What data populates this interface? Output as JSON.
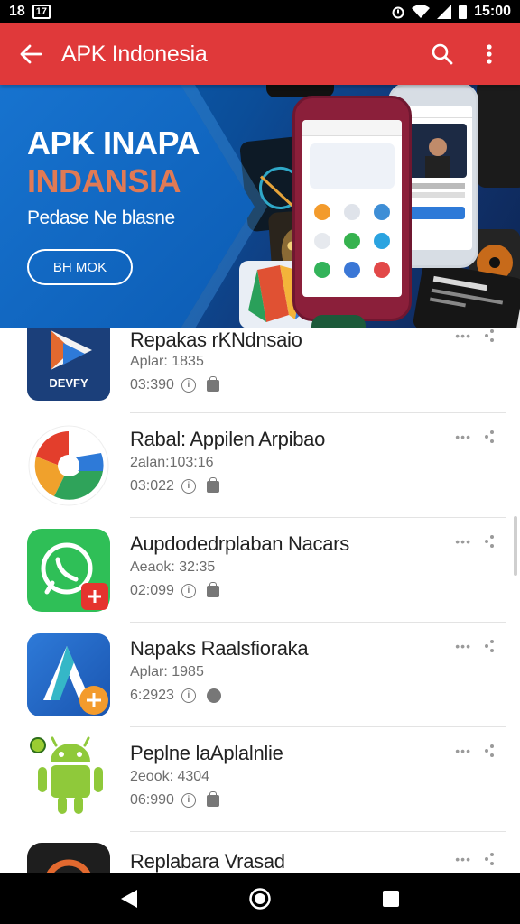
{
  "status_bar": {
    "left_text": "18",
    "left_badge": "17",
    "time": "15:00",
    "icons": [
      "alarm-icon",
      "wifi-icon",
      "signal-icon",
      "battery-icon"
    ]
  },
  "app_bar": {
    "title": "APK Indonesia",
    "icons": [
      "back-arrow-icon",
      "search-icon",
      "more-vert-icon"
    ]
  },
  "banner": {
    "headline_1": "APK INAPA",
    "headline_2": "INDANSIA",
    "subtitle": "Pedase Ne blasne",
    "button_label": "BH MOK",
    "colors": {
      "accent_orange": "#e07a55",
      "blue": "#0c5cb4"
    }
  },
  "apps": [
    {
      "title": "Repakas rKNdnsaio",
      "subtitle": "Aplar: 1835",
      "meta": "03:390",
      "icon_label": "DEVFY",
      "icon": "play-store-like-icon"
    },
    {
      "title": "Rabal: Appilen Arpibao",
      "subtitle": "2alan:103:16",
      "meta": "03:022",
      "icon": "google-like-g-icon"
    },
    {
      "title": "Aupdodedrplaban Nacars",
      "subtitle": "Aeaok: 32:35",
      "meta": "02:099",
      "icon": "whatsapp-like-icon"
    },
    {
      "title": "Napaks Raalsfioraka",
      "subtitle": "Aplar: 1985",
      "meta": "6:2923",
      "icon": "android-studio-like-icon"
    },
    {
      "title": "Peplne laAplalnlie",
      "subtitle": "2eook: 4304",
      "meta": "06:990",
      "icon": "android-robot-icon"
    },
    {
      "title": "Replabara Vrasad",
      "subtitle": "",
      "meta": "",
      "icon": "dark-app-icon"
    }
  ],
  "row_actions_text": "•••",
  "nav_bar": {
    "icons": [
      "back-triangle-icon",
      "home-circle-icon",
      "recents-square-icon"
    ]
  }
}
